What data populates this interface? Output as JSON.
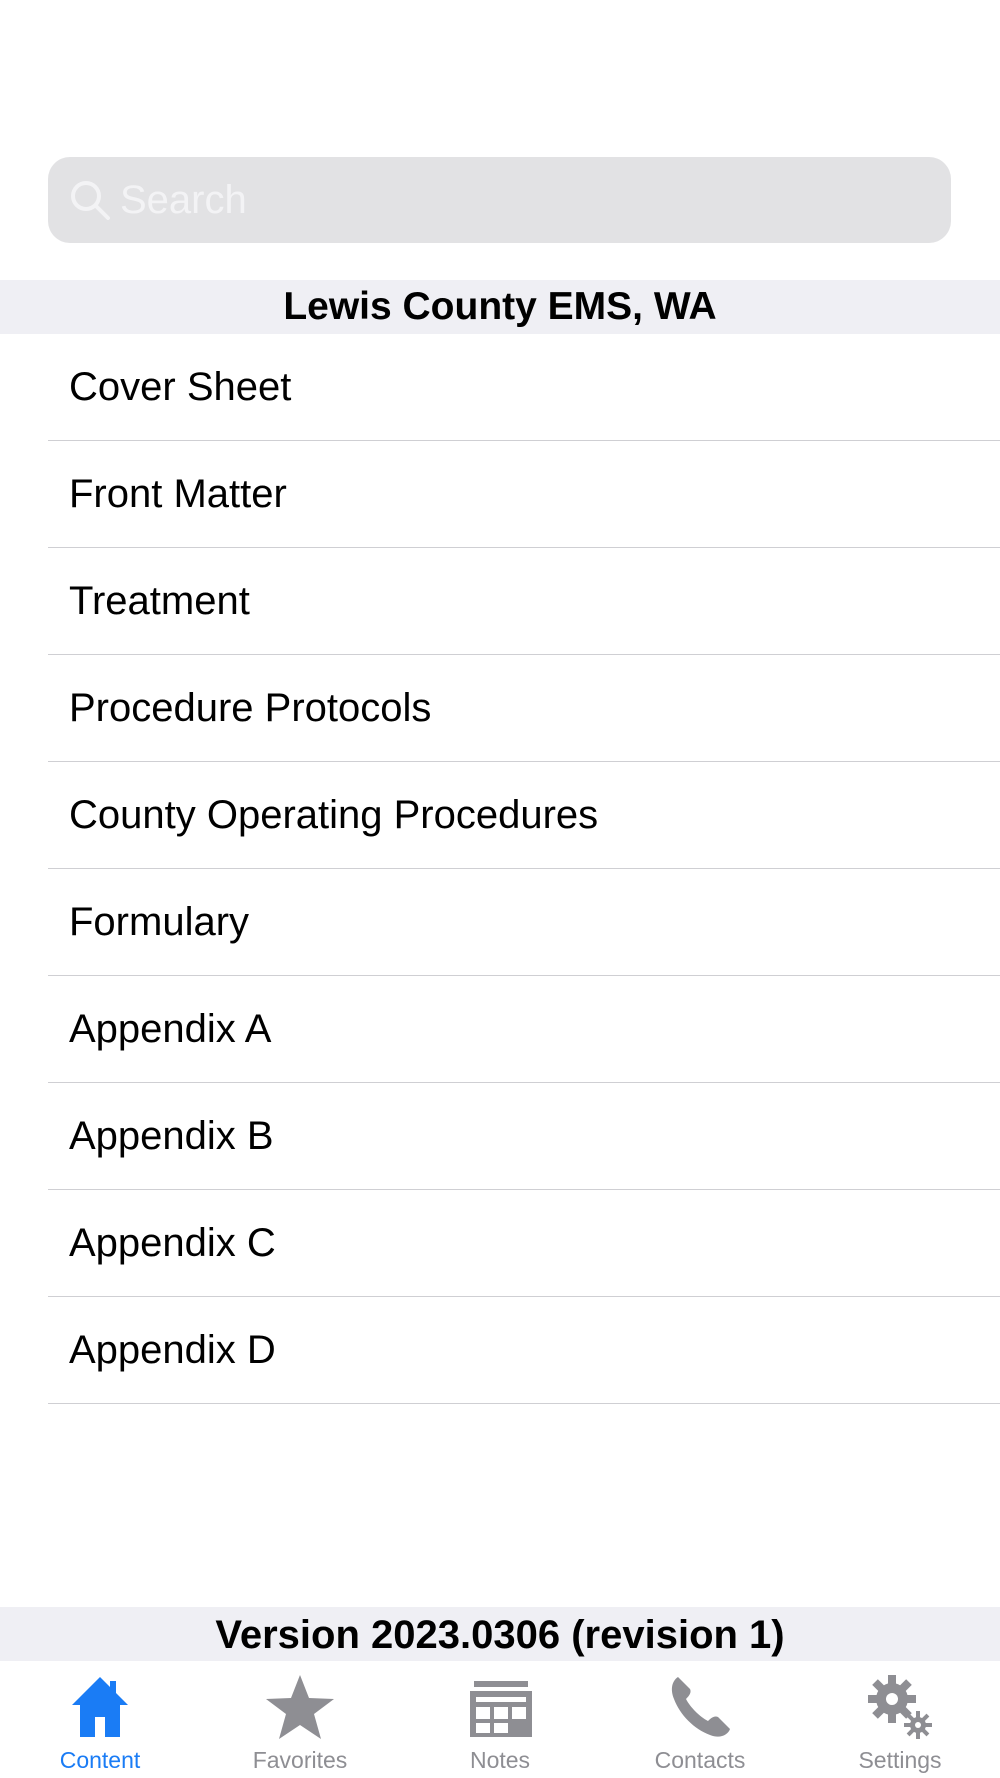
{
  "search": {
    "placeholder": "Search"
  },
  "section": {
    "title": "Lewis County EMS, WA"
  },
  "menu": {
    "items": [
      {
        "label": "Cover Sheet"
      },
      {
        "label": "Front Matter"
      },
      {
        "label": "Treatment"
      },
      {
        "label": "Procedure Protocols"
      },
      {
        "label": "County Operating Procedures"
      },
      {
        "label": "Formulary"
      },
      {
        "label": "Appendix A"
      },
      {
        "label": "Appendix B"
      },
      {
        "label": "Appendix C"
      },
      {
        "label": "Appendix D"
      }
    ]
  },
  "footer": {
    "version": "Version 2023.0306 (revision 1)"
  },
  "tabbar": {
    "active": "Content",
    "tabs": [
      {
        "label": "Content",
        "icon": "home-icon"
      },
      {
        "label": "Favorites",
        "icon": "star-icon"
      },
      {
        "label": "Notes",
        "icon": "notes-icon"
      },
      {
        "label": "Contacts",
        "icon": "phone-icon"
      },
      {
        "label": "Settings",
        "icon": "gear-icon"
      }
    ]
  },
  "colors": {
    "accent": "#1a7cf5",
    "inactive": "#8e8e93",
    "header_bg": "#efeff4",
    "search_bg": "#e2e2e4"
  }
}
